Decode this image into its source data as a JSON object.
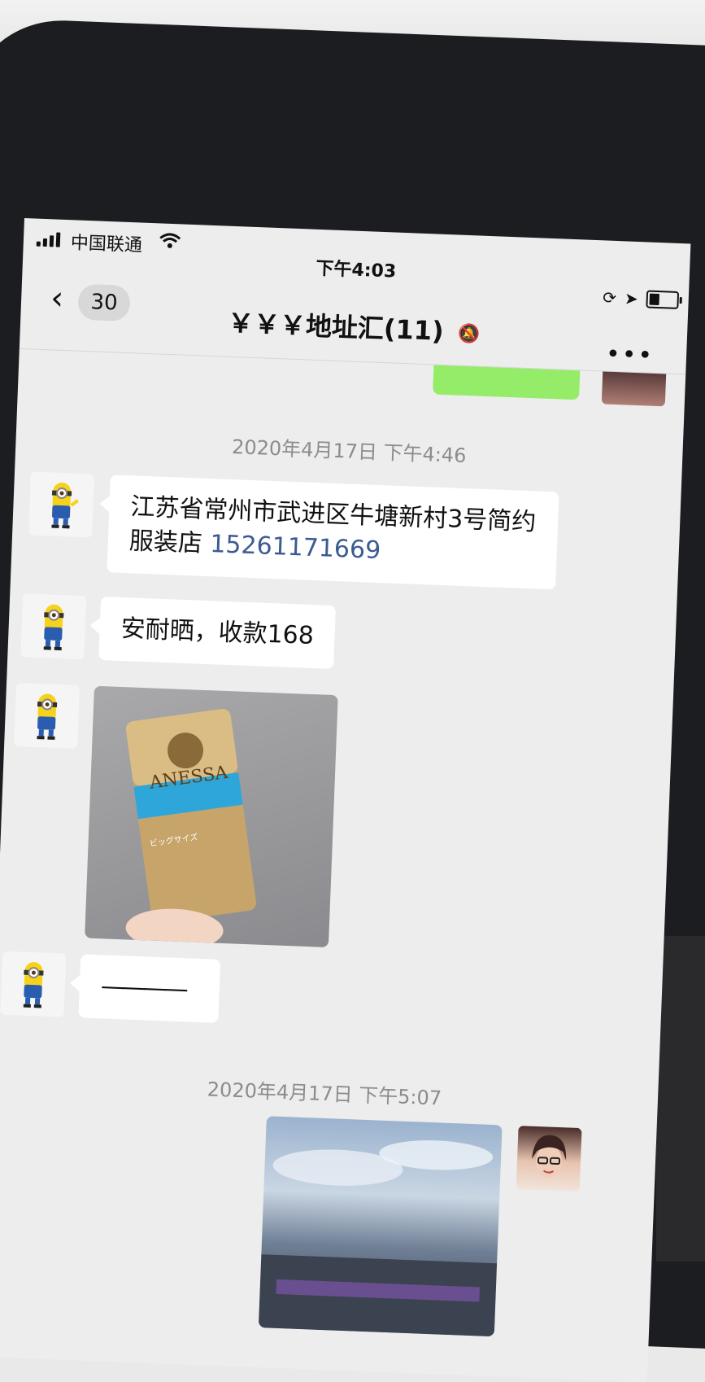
{
  "status_bar": {
    "carrier": "中国联通",
    "time": "下午4:03"
  },
  "nav": {
    "back_count": "30",
    "title": "￥￥￥地址汇(11)"
  },
  "messages": [
    {
      "type": "timestamp",
      "text": "2020年4月17日 下午4:46"
    },
    {
      "type": "text",
      "sender": "minion",
      "text": "江苏省常州市武进区牛塘新村3号简约服装店",
      "phone": "15261171669"
    },
    {
      "type": "text",
      "sender": "minion",
      "text": "安耐晒，收款168"
    },
    {
      "type": "image",
      "sender": "minion",
      "caption": "ANESSA",
      "caption2": "ビッグサイズ"
    },
    {
      "type": "text",
      "sender": "minion",
      "text": "————"
    },
    {
      "type": "timestamp",
      "text": "2020年4月17日 下午5:07"
    },
    {
      "type": "image",
      "sender": "me",
      "description": "sky"
    }
  ],
  "colors": {
    "background": "#ededed",
    "bubble_self": "#95ec69",
    "bubble_other": "#ffffff",
    "link": "#3b5b92"
  }
}
